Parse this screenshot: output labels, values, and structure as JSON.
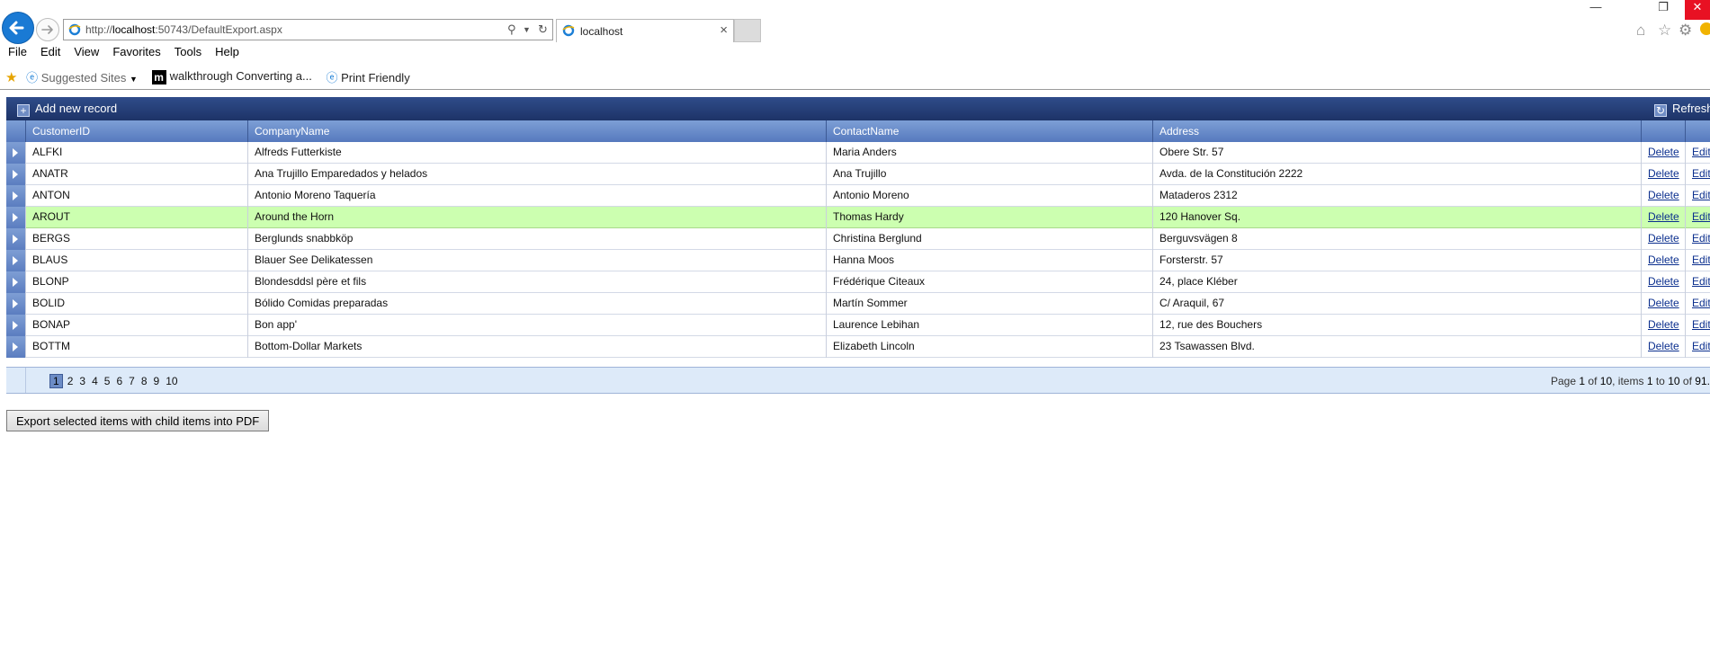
{
  "browser": {
    "url_prefix": "http://",
    "url_host": "localhost",
    "url_rest": ":50743/DefaultExport.aspx",
    "tab_title": "localhost",
    "menu": [
      "File",
      "Edit",
      "View",
      "Favorites",
      "Tools",
      "Help"
    ],
    "favorites": {
      "suggested": "Suggested Sites",
      "walkthrough": "walkthrough Converting a...",
      "print": "Print Friendly"
    }
  },
  "grid": {
    "add_label": "Add new record",
    "refresh_label": "Refresh",
    "columns": [
      "CustomerID",
      "CompanyName",
      "ContactName",
      "Address"
    ],
    "delete_label": "Delete",
    "edit_label": "Edit",
    "selected_row": 3,
    "rows": [
      {
        "id": "ALFKI",
        "company": "Alfreds Futterkiste",
        "contact": "Maria Anders",
        "address": "Obere Str. 57"
      },
      {
        "id": "ANATR",
        "company": "Ana Trujillo Emparedados y helados",
        "contact": "Ana Trujillo",
        "address": "Avda. de la Constitución 2222"
      },
      {
        "id": "ANTON",
        "company": "Antonio Moreno Taquería",
        "contact": "Antonio Moreno",
        "address": "Mataderos 2312"
      },
      {
        "id": "AROUT",
        "company": "Around the Horn",
        "contact": "Thomas Hardy",
        "address": "120 Hanover Sq."
      },
      {
        "id": "BERGS",
        "company": "Berglunds snabbköp",
        "contact": "Christina Berglund",
        "address": "Berguvsvägen 8"
      },
      {
        "id": "BLAUS",
        "company": "Blauer See Delikatessen",
        "contact": "Hanna Moos",
        "address": "Forsterstr. 57"
      },
      {
        "id": "BLONP",
        "company": "Blondesddsl père et fils",
        "contact": "Frédérique Citeaux",
        "address": "24, place Kléber"
      },
      {
        "id": "BOLID",
        "company": "Bólido Comidas preparadas",
        "contact": "Martín Sommer",
        "address": "C/ Araquil, 67"
      },
      {
        "id": "BONAP",
        "company": "Bon app'",
        "contact": "Laurence Lebihan",
        "address": "12, rue des Bouchers"
      },
      {
        "id": "BOTTM",
        "company": "Bottom-Dollar Markets",
        "contact": "Elizabeth Lincoln",
        "address": "23 Tsawassen Blvd."
      }
    ],
    "pager": {
      "pages": [
        "1",
        "2",
        "3",
        "4",
        "5",
        "6",
        "7",
        "8",
        "9",
        "10"
      ],
      "current": "1",
      "info_page_label": "Page",
      "info_page": "1",
      "info_of": "of",
      "info_pages_total": "10",
      "info_items_label": ", items",
      "info_from": "1",
      "info_to_label": "to",
      "info_to": "10",
      "info_of2": "of",
      "info_total": "91."
    }
  },
  "export_button_label": "Export selected items with child items into PDF"
}
